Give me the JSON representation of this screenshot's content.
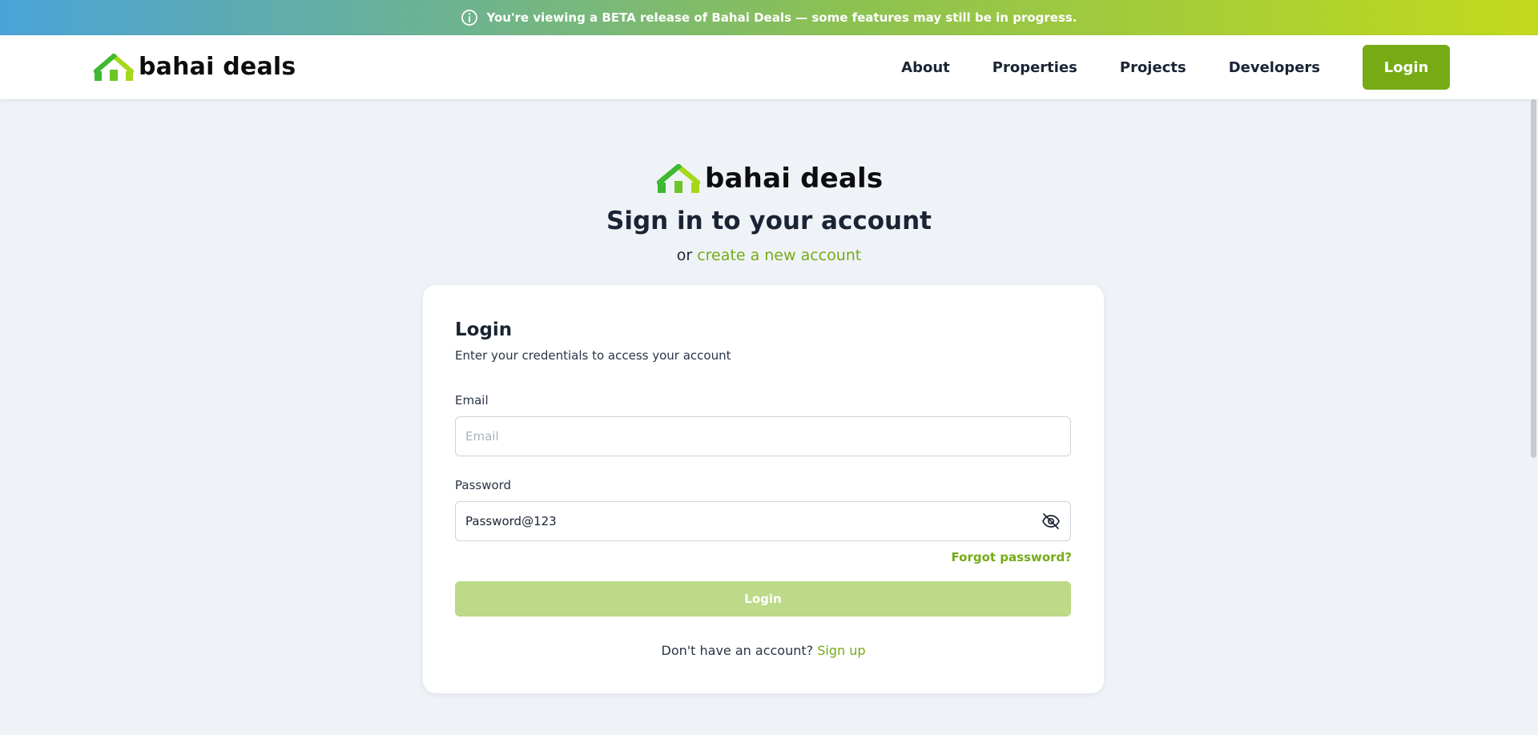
{
  "banner": {
    "text": "You're viewing a BETA release of Bahai Deals — some features may still be in progress.",
    "icon": "info-icon"
  },
  "brand": {
    "name": "bahai deals",
    "colors": {
      "primary": "#76ab15",
      "primary_disabled": "#bcda87",
      "house_green": "#3fb832",
      "house_lime": "#a6d81a"
    }
  },
  "nav": {
    "links": [
      "About",
      "Properties",
      "Projects",
      "Developers"
    ],
    "login_label": "Login"
  },
  "auth": {
    "title": "Sign in to your account",
    "subtitle_prefix": "or",
    "subtitle_link": "create a new account"
  },
  "card": {
    "title": "Login",
    "description": "Enter your credentials to access your account",
    "email": {
      "label": "Email",
      "placeholder": "Email",
      "value": ""
    },
    "password": {
      "label": "Password",
      "value": "Password@123",
      "toggle_icon": "eye-off-icon"
    },
    "forgot_label": "Forgot password?",
    "submit_label": "Login",
    "signup_prompt": "Don't have an account?",
    "signup_link": "Sign up"
  }
}
